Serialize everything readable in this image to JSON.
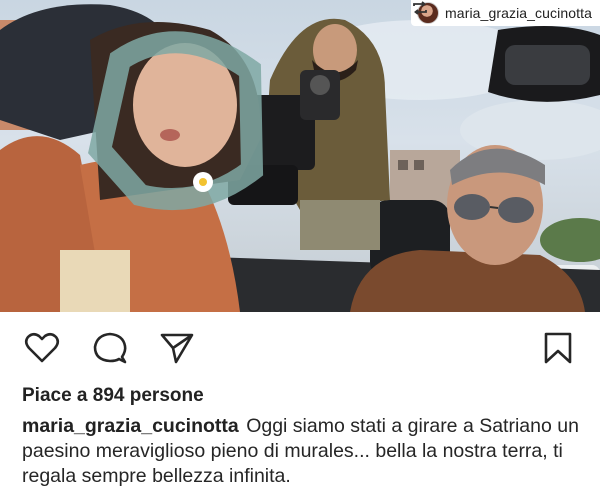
{
  "repost": {
    "username": "maria_grazia_cucinotta",
    "icon": "repost-icon"
  },
  "photo": {
    "description_icon": "photo"
  },
  "actions": {
    "like_icon": "heart-icon",
    "comment_icon": "comment-icon",
    "share_icon": "send-icon",
    "save_icon": "bookmark-icon"
  },
  "likes": {
    "text": "Piace a 894 persone"
  },
  "caption": {
    "username": "maria_grazia_cucinotta",
    "text": "Oggi siamo stati a girare a Satriano un paesino meraviglioso pieno di murales... bella la nostra terra, ti regala sempre bellezza infinita."
  },
  "colors": {
    "text": "#262626",
    "icon_stroke": "#262626",
    "background": "#ffffff"
  }
}
